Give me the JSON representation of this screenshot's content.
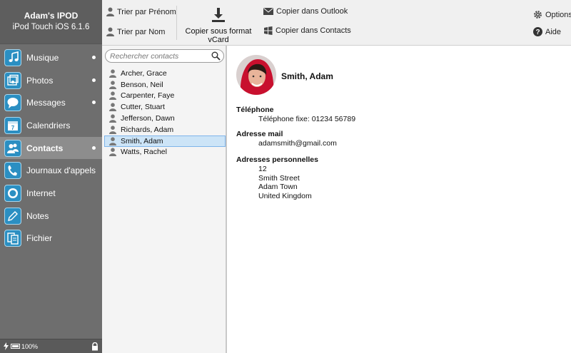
{
  "device": {
    "name": "Adam's IPOD",
    "model": "iPod Touch iOS 6.1.6"
  },
  "nav": [
    {
      "label": "Musique",
      "icon": "music-icon",
      "dot": true
    },
    {
      "label": "Photos",
      "icon": "photos-icon",
      "dot": true
    },
    {
      "label": "Messages",
      "icon": "messages-icon",
      "dot": true
    },
    {
      "label": "Calendriers",
      "icon": "calendar-icon",
      "dot": false
    },
    {
      "label": "Contacts",
      "icon": "contacts-icon",
      "dot": true,
      "active": true
    },
    {
      "label": "Journaux d'appels",
      "icon": "phone-icon",
      "dot": false
    },
    {
      "label": "Internet",
      "icon": "internet-icon",
      "dot": false
    },
    {
      "label": "Notes",
      "icon": "notes-icon",
      "dot": false
    },
    {
      "label": "Fichier",
      "icon": "files-icon",
      "dot": false
    }
  ],
  "status": {
    "battery": "100%"
  },
  "toolbar": {
    "sort_first": "Trier par Prénom",
    "sort_last": "Trier par Nom",
    "vcard": "Copier sous format vCard",
    "outlook": "Copier dans Outlook",
    "contacts": "Copier dans Contacts",
    "options": "Options",
    "help": "Aide"
  },
  "search": {
    "placeholder": "Rechercher contacts"
  },
  "contacts": [
    "Archer, Grace",
    "Benson, Neil",
    "Carpenter, Faye",
    "Cutter, Stuart",
    "Jefferson, Dawn",
    "Richards, Adam",
    "Smith, Adam",
    "Watts, Rachel"
  ],
  "selected_index": 6,
  "detail": {
    "name": "Smith, Adam",
    "phone_title": "Téléphone",
    "phone_line": "Téléphone fixe:  01234 56789",
    "email_title": "Adresse mail",
    "email": "adamsmith@gmail.com",
    "address_title": "Adresses personnelles",
    "address_lines": [
      "12",
      "Smith Street",
      "Adam Town",
      "United Kingdom"
    ]
  },
  "colors": {
    "accent": "#2b8fc2",
    "selected": "#cce4f7",
    "sidebar": "#6e6e6e"
  }
}
